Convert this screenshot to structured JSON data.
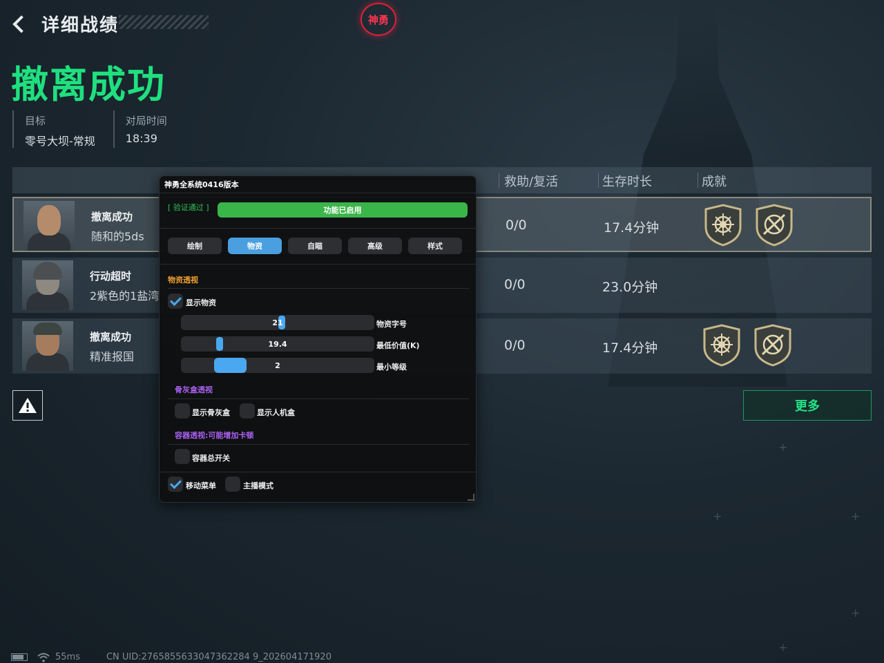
{
  "header": {
    "title": "详细战绩",
    "logo": "神勇",
    "result_title": "撤离成功"
  },
  "meta": {
    "target_label": "目标",
    "target_value": "零号大坝-常规",
    "duration_label": "对局时间",
    "duration_value": "18:39"
  },
  "table": {
    "columns": [
      "救助/复活",
      "生存时长",
      "成就"
    ],
    "rows": [
      {
        "status": "撤离成功",
        "name": "随和的5ds",
        "assist": "0/0",
        "survival": "17.4分钟",
        "badges": [
          "achievement-star-icon",
          "achievement-sword-icon"
        ]
      },
      {
        "status": "行动超时",
        "name": "2紫色的1盐湾",
        "assist": "0/0",
        "survival": "23.0分钟",
        "badges": []
      },
      {
        "status": "撤离成功",
        "name": "精准报国",
        "assist": "0/0",
        "survival": "17.4分钟",
        "badges": [
          "achievement-star-icon",
          "achievement-sword-icon"
        ]
      }
    ]
  },
  "buttons": {
    "more": "更多"
  },
  "status_bar": {
    "ping": "55ms",
    "uid": "CN UID:2765855633047362284 9_202604171920"
  },
  "panel": {
    "title": "神勇全系统0416版本",
    "verify": "[ 验证通过 ]",
    "enabled": "功能已启用",
    "tabs": [
      "绘制",
      "物资",
      "自瞄",
      "高级",
      "样式"
    ],
    "active_tab": "物资",
    "sections": {
      "supplies": "物资透视",
      "box": "骨灰盒透视",
      "container": "容器透视:可能增加卡顿"
    },
    "show_supplies": "显示物资",
    "sliders": [
      {
        "value": "21",
        "label": "物资字号",
        "level": 0.52
      },
      {
        "value": "19.4",
        "label": "最低价值(K)",
        "level": 0.2
      },
      {
        "value": "2",
        "label": "最小等级",
        "level": 0.34
      }
    ],
    "show_box": "显示骨灰盒",
    "show_bot": "显示人机盒",
    "container_switch": "容器总开关",
    "move_menu": "移动菜单",
    "streamer_mode": "主播模式",
    "colors": {
      "accent_blue": "#4a9fe0",
      "green": "#3ab54a",
      "orange": "#f0a030",
      "purple": "#a860f0"
    }
  }
}
